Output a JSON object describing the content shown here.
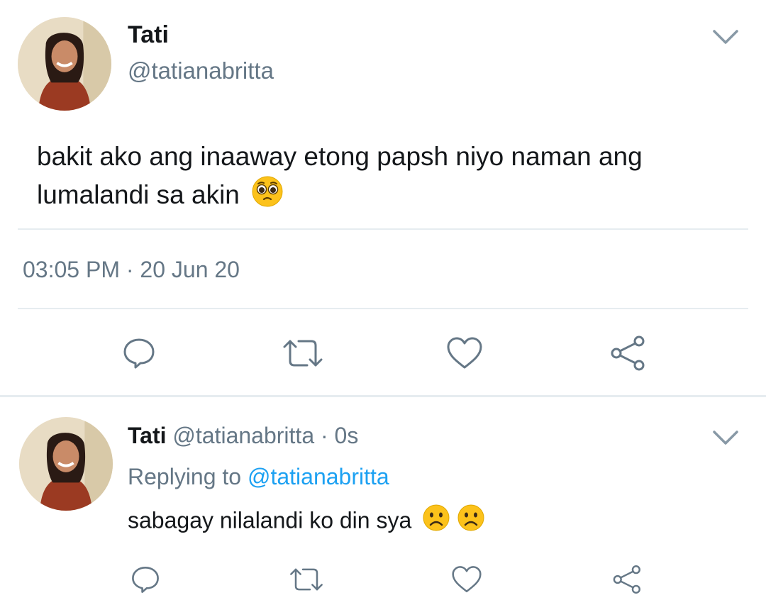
{
  "main_tweet": {
    "display_name": "Tati",
    "handle": "@tatianabritta",
    "text": "bakit ako ang inaaway etong papsh niyo naman ang lumalandi sa akin",
    "text_line1": "bakit ako ang inaaway etong papsh niyo naman ang",
    "text_line2": "lumalandi sa akin",
    "emoji": "pleading-face",
    "timestamp": "03:05 PM · 20 Jun 20"
  },
  "reply_tweet": {
    "display_name": "Tati",
    "handle": "@tatianabritta",
    "time_ago": "· 0s",
    "replying_prefix": "Replying to",
    "replying_handle": "@tatianabritta",
    "text": "sabagay nilalandi ko din sya",
    "emojis": [
      "frowning-face",
      "frowning-face"
    ]
  },
  "actions": [
    "reply-icon",
    "retweet-icon",
    "like-icon",
    "share-icon"
  ],
  "colors": {
    "text": "#14171a",
    "muted": "#657786",
    "link": "#1da1f2",
    "divider": "#e6ecf0",
    "emoji": "#fcc21b"
  }
}
